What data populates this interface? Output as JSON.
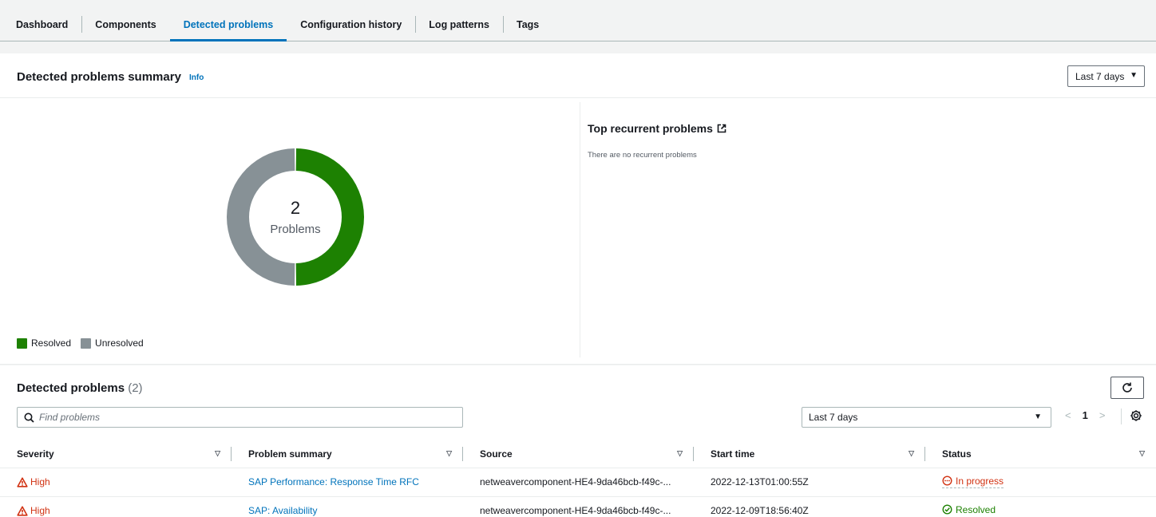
{
  "tabs": [
    {
      "label": "Dashboard",
      "active": false
    },
    {
      "label": "Components",
      "active": false
    },
    {
      "label": "Detected problems",
      "active": true
    },
    {
      "label": "Configuration history",
      "active": false
    },
    {
      "label": "Log patterns",
      "active": false
    },
    {
      "label": "Tags",
      "active": false
    }
  ],
  "summary": {
    "title": "Detected problems summary",
    "info_label": "Info",
    "range": "Last 7 days",
    "donut": {
      "total": "2",
      "label": "Problems",
      "resolved_fraction": 0.5,
      "unresolved_fraction": 0.5
    },
    "legend": {
      "resolved": "Resolved",
      "unresolved": "Unresolved"
    },
    "colors": {
      "resolved": "#1d8102",
      "unresolved": "#879196",
      "accent": "#0073bb",
      "error": "#d13212"
    },
    "recurrent_title": "Top recurrent problems",
    "recurrent_empty": "There are no recurrent problems"
  },
  "problems": {
    "title": "Detected problems",
    "count": "(2)",
    "search_placeholder": "Find problems",
    "filter_range": "Last 7 days",
    "page": "1",
    "columns": [
      "Severity",
      "Problem summary",
      "Source",
      "Start time",
      "Status"
    ],
    "rows": [
      {
        "severity": "High",
        "summary": "SAP Performance: Response Time RFC",
        "source": "netweavercomponent-HE4-9da46bcb-f49c-...",
        "start": "2022-12-13T01:00:55Z",
        "status": "In progress"
      },
      {
        "severity": "High",
        "summary": "SAP: Availability",
        "source": "netweavercomponent-HE4-9da46bcb-f49c-...",
        "start": "2022-12-09T18:56:40Z",
        "status": "Resolved"
      }
    ]
  }
}
